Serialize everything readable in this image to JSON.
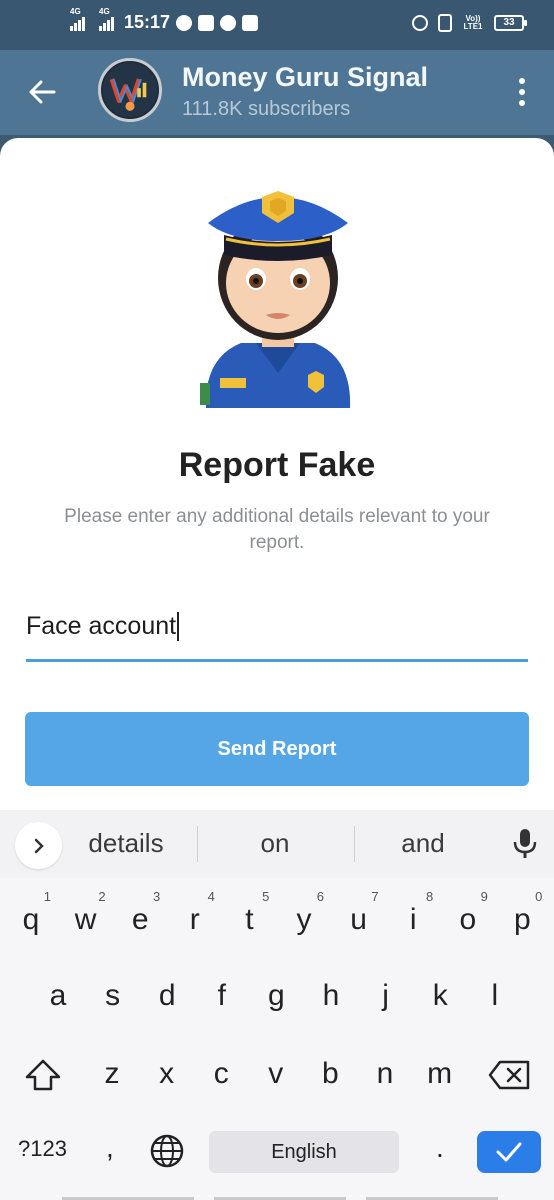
{
  "status_bar": {
    "time": "15:17",
    "network_1": "4G",
    "network_2": "4G",
    "volte": "Vo)) LTE1",
    "battery": "33"
  },
  "header": {
    "channel_name": "Money Guru Signal",
    "subscribers": "111.8K subscribers"
  },
  "dialog": {
    "title": "Report Fake",
    "description": "Please enter any additional details relevant to your report.",
    "input_value": "Face account",
    "send_label": "Send Report"
  },
  "keyboard": {
    "suggestions": [
      "details",
      "on",
      "and"
    ],
    "row1": [
      {
        "k": "q",
        "h": "1"
      },
      {
        "k": "w",
        "h": "2"
      },
      {
        "k": "e",
        "h": "3"
      },
      {
        "k": "r",
        "h": "4"
      },
      {
        "k": "t",
        "h": "5"
      },
      {
        "k": "y",
        "h": "6"
      },
      {
        "k": "u",
        "h": "7"
      },
      {
        "k": "i",
        "h": "8"
      },
      {
        "k": "o",
        "h": "9"
      },
      {
        "k": "p",
        "h": "0"
      }
    ],
    "row2": [
      "a",
      "s",
      "d",
      "f",
      "g",
      "h",
      "j",
      "k",
      "l"
    ],
    "row3": [
      "z",
      "x",
      "c",
      "v",
      "b",
      "n",
      "m"
    ],
    "symbols_label": "?123",
    "comma": ",",
    "space_label": "English",
    "period": "."
  }
}
